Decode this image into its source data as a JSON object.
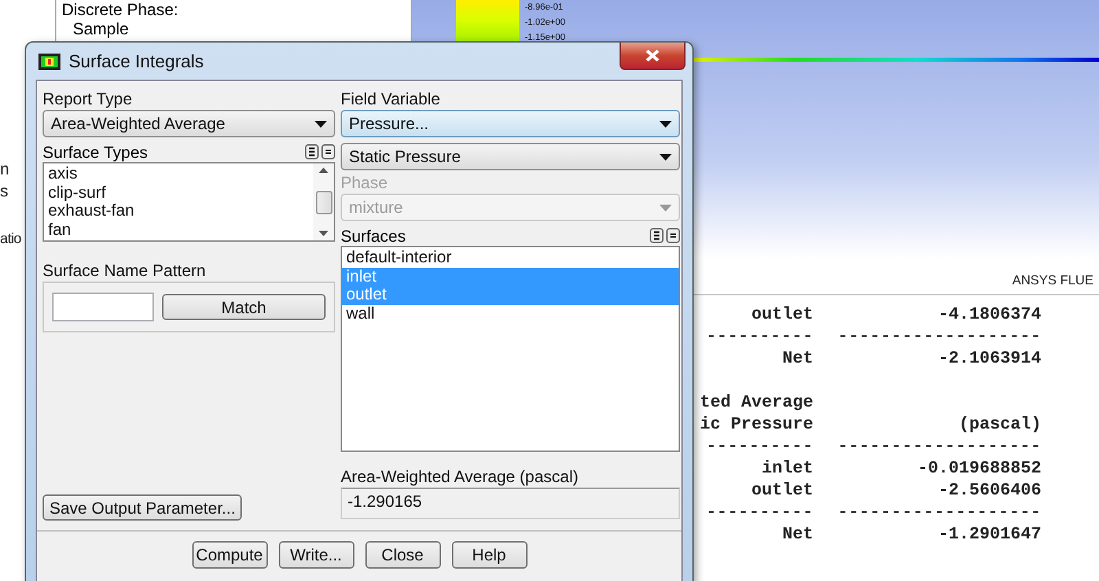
{
  "left_edge_texts": [
    "n",
    "s",
    "atio"
  ],
  "tree_panel": {
    "items": [
      {
        "label": "Discrete Phase:",
        "children": [
          {
            "label": "Sample"
          }
        ]
      }
    ]
  },
  "graphics": {
    "colorbar_labels": [
      "-8.96e-01",
      "-1.02e+00",
      "-1.15e+00"
    ],
    "banner": "ANSYS FLUE"
  },
  "console": {
    "lines": [
      {
        "kind": "row",
        "col_1": "outlet",
        "col_2": "-4.1806374"
      },
      {
        "kind": "rule",
        "col_1": "----------",
        "col_2": "-------------------"
      },
      {
        "kind": "row",
        "col_1": "Net",
        "col_2": "-2.1063914"
      },
      {
        "kind": "blank"
      },
      {
        "kind": "row",
        "col_1": "ted Average"
      },
      {
        "kind": "row",
        "col_1": "ic Pressure",
        "col_2": "(pascal)"
      },
      {
        "kind": "rule",
        "col_1": "----------",
        "col_2": "-------------------"
      },
      {
        "kind": "row",
        "col_1": "inlet",
        "col_2": "-0.019688852"
      },
      {
        "kind": "row",
        "col_1": "outlet",
        "col_2": "-2.5606406"
      },
      {
        "kind": "rule",
        "col_1": "----------",
        "col_2": "-------------------"
      },
      {
        "kind": "row",
        "col_1": "Net",
        "col_2": "-1.2901647"
      }
    ]
  },
  "dialog": {
    "title": "Surface Integrals",
    "report_type": {
      "label": "Report Type",
      "value": "Area-Weighted Average"
    },
    "surface_types": {
      "label": "Surface Types",
      "items": [
        {
          "label": "axis",
          "selected": false
        },
        {
          "label": "clip-surf",
          "selected": false
        },
        {
          "label": "exhaust-fan",
          "selected": false
        },
        {
          "label": "fan",
          "selected": false
        }
      ]
    },
    "surface_name_pattern": {
      "label": "Surface Name Pattern",
      "button": "Match"
    },
    "save_button": "Save Output Parameter...",
    "field_variable": {
      "label": "Field Variable",
      "value": "Pressure...",
      "quantity": "Static Pressure"
    },
    "phase": {
      "label": "Phase",
      "value": "mixture",
      "disabled": true
    },
    "surfaces": {
      "label": "Surfaces",
      "items": [
        {
          "label": "default-interior",
          "selected": false
        },
        {
          "label": "inlet",
          "selected": true
        },
        {
          "label": "outlet",
          "selected": true
        },
        {
          "label": "wall",
          "selected": false
        }
      ]
    },
    "result": {
      "label": "Area-Weighted Average (pascal)",
      "value": "-1.290165"
    },
    "buttons": [
      "Compute",
      "Write...",
      "Close",
      "Help"
    ]
  }
}
